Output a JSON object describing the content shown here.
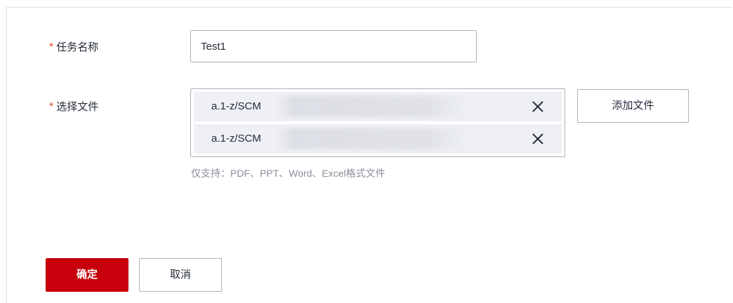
{
  "form": {
    "task_name": {
      "required_mark": "*",
      "label": "任务名称",
      "value": "Test1"
    },
    "select_file": {
      "required_mark": "*",
      "label": "选择文件",
      "files": [
        {
          "name": "a.1-z/SCM",
          "remove_icon": "close-icon"
        },
        {
          "name": "a.1-z/SCM",
          "remove_icon": "close-icon"
        }
      ],
      "add_button": "添加文件",
      "hint": "仅支持：PDF、PPT、Word、Excel格式文件"
    }
  },
  "actions": {
    "confirm": "确定",
    "cancel": "取消"
  },
  "colors": {
    "primary": "#c7000b",
    "required": "#d84e2c",
    "border": "#adb0b8",
    "file_row_bg": "#eef0f5",
    "hint": "#8a8e99"
  }
}
